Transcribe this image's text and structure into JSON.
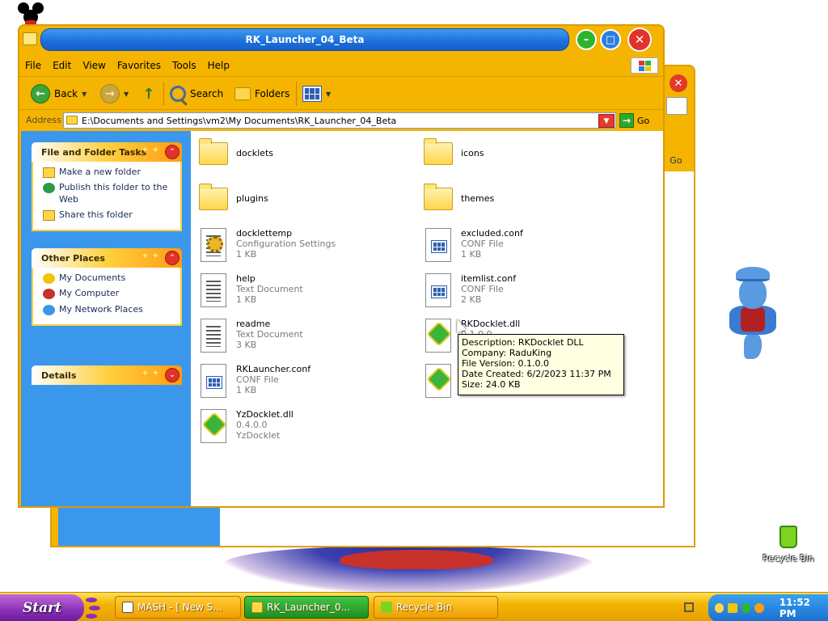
{
  "window": {
    "title": "RK_Launcher_04_Beta",
    "menu": [
      "File",
      "Edit",
      "View",
      "Favorites",
      "Tools",
      "Help"
    ],
    "toolbar": {
      "back": "Back",
      "search": "Search",
      "folders": "Folders"
    },
    "address": {
      "label": "Address",
      "value": "E:\\Documents and Settings\\vm2\\My Documents\\RK_Launcher_04_Beta",
      "go": "Go"
    }
  },
  "background_window": {
    "go": "Go"
  },
  "task_pane": {
    "file_folder_tasks": {
      "title": "File and Folder Tasks",
      "items": [
        "Make a new folder",
        "Publish this folder to the Web",
        "Share this folder"
      ]
    },
    "other_places": {
      "title": "Other Places",
      "items": [
        "My Documents",
        "My Computer",
        "My Network Places"
      ]
    },
    "details": {
      "title": "Details"
    }
  },
  "files": [
    {
      "name": "docklets",
      "type": "folder"
    },
    {
      "name": "icons",
      "type": "folder"
    },
    {
      "name": "plugins",
      "type": "folder"
    },
    {
      "name": "themes",
      "type": "folder"
    },
    {
      "name": "docklettemp",
      "line2": "Configuration Settings",
      "line3": "1 KB",
      "type": "settings"
    },
    {
      "name": "excluded.conf",
      "line2": "CONF File",
      "line3": "1 KB",
      "type": "conf"
    },
    {
      "name": "help",
      "line2": "Text Document",
      "line3": "1 KB",
      "type": "text"
    },
    {
      "name": "itemlist.conf",
      "line2": "CONF File",
      "line3": "2 KB",
      "type": "conf"
    },
    {
      "name": "readme",
      "line2": "Text Document",
      "line3": "3 KB",
      "type": "text"
    },
    {
      "name": "RKDocklet.dll",
      "line2": "0.1.0.0",
      "line3": "",
      "type": "dll"
    },
    {
      "name": "RKLauncher.conf",
      "line2": "CONF File",
      "line3": "1 KB",
      "type": "conf"
    },
    {
      "name": "",
      "line2": "",
      "line3": "",
      "type": "dll"
    },
    {
      "name": "YzDocklet.dll",
      "line2": "0.4.0.0",
      "line3": "YzDocklet",
      "type": "dll"
    }
  ],
  "tooltip": {
    "description": "Description: RKDocklet DLL",
    "company": "Company: RaduKing",
    "version": "File Version: 0.1.0.0",
    "created": "Date Created: 6/2/2023 11:37 PM",
    "size": "Size: 24.0 KB"
  },
  "desktop": {
    "recycle_bin_label": "Recycle Bin"
  },
  "taskbar": {
    "start": "Start",
    "tasks": [
      {
        "label": "MASH - [ New S...",
        "active": false
      },
      {
        "label": "RK_Launcher_0...",
        "active": true
      },
      {
        "label": "Recycle Bin",
        "active": false
      }
    ],
    "clock": "11:52 PM"
  },
  "colors": {
    "window_frame": "#f4b400",
    "title_pill": "#1b6fdc",
    "left_pane": "#3b97ec",
    "tooltip_bg": "#ffffe1"
  }
}
